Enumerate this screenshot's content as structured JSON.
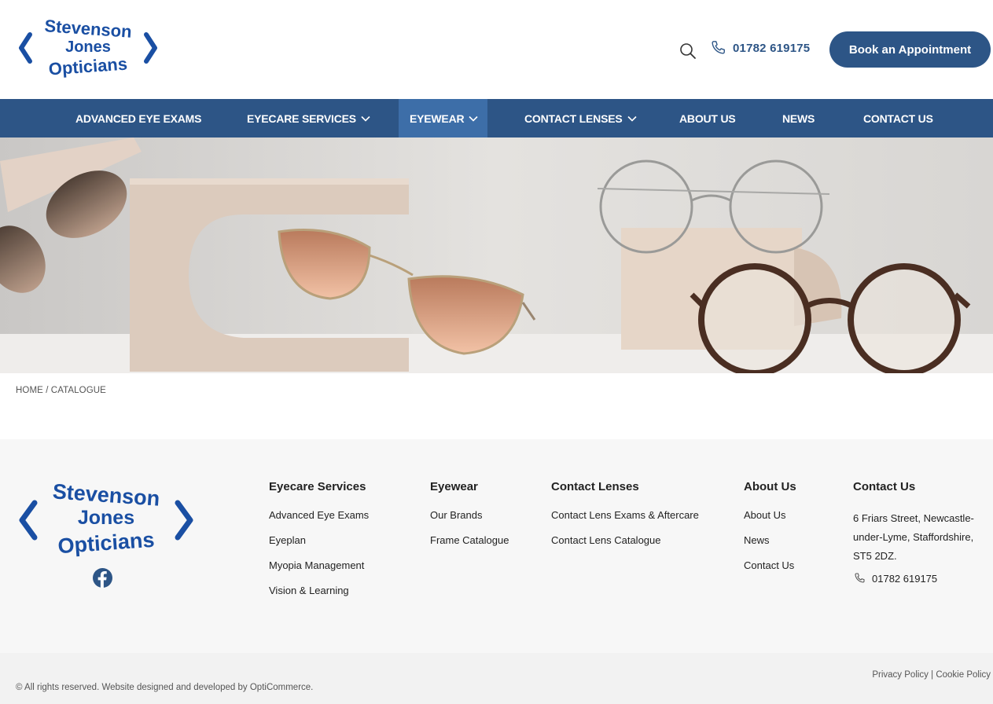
{
  "brand": {
    "logo_line1": "Stevenson",
    "logo_line2": "Jones",
    "logo_line3": "Opticians",
    "color_primary": "#2d5586",
    "color_logo": "#1a4fa3",
    "color_nav_active": "#3d6ea8"
  },
  "header": {
    "search_icon": "search-icon",
    "phone": "01782 619175",
    "book_button": "Book an Appointment"
  },
  "nav": {
    "items": [
      {
        "label": "ADVANCED EYE EXAMS",
        "dropdown": false
      },
      {
        "label": "EYECARE SERVICES",
        "dropdown": true
      },
      {
        "label": "EYEWEAR",
        "dropdown": true,
        "active": true
      },
      {
        "label": "CONTACT LENSES",
        "dropdown": true
      },
      {
        "label": "ABOUT US",
        "dropdown": false
      },
      {
        "label": "NEWS",
        "dropdown": false
      },
      {
        "label": "CONTACT US",
        "dropdown": false
      }
    ]
  },
  "breadcrumb": {
    "home": "HOME",
    "separator": " / ",
    "current": "CATALOGUE"
  },
  "footer": {
    "columns": [
      {
        "title": "Eyecare Services",
        "links": [
          "Advanced Eye Exams",
          "Eyeplan",
          "Myopia Management",
          "Vision & Learning"
        ]
      },
      {
        "title": "Eyewear",
        "links": [
          "Our Brands",
          "Frame Catalogue"
        ]
      },
      {
        "title": "Contact Lenses",
        "links": [
          "Contact Lens Exams & Aftercare",
          "Contact Lens Catalogue"
        ]
      },
      {
        "title": "About Us",
        "links": [
          "About Us",
          "News",
          "Contact Us"
        ]
      }
    ],
    "contact": {
      "title": "Contact Us",
      "address": "6 Friars Street, Newcastle-under-Lyme, Staffordshire, ST5 2DZ.",
      "phone": "01782 619175"
    },
    "social_icon": "facebook-icon"
  },
  "bottom": {
    "copyright": "© All rights reserved. Website designed and developed by OptiCommerce.",
    "privacy": "Privacy Policy",
    "separator": " | ",
    "cookie": "Cookie Policy"
  }
}
